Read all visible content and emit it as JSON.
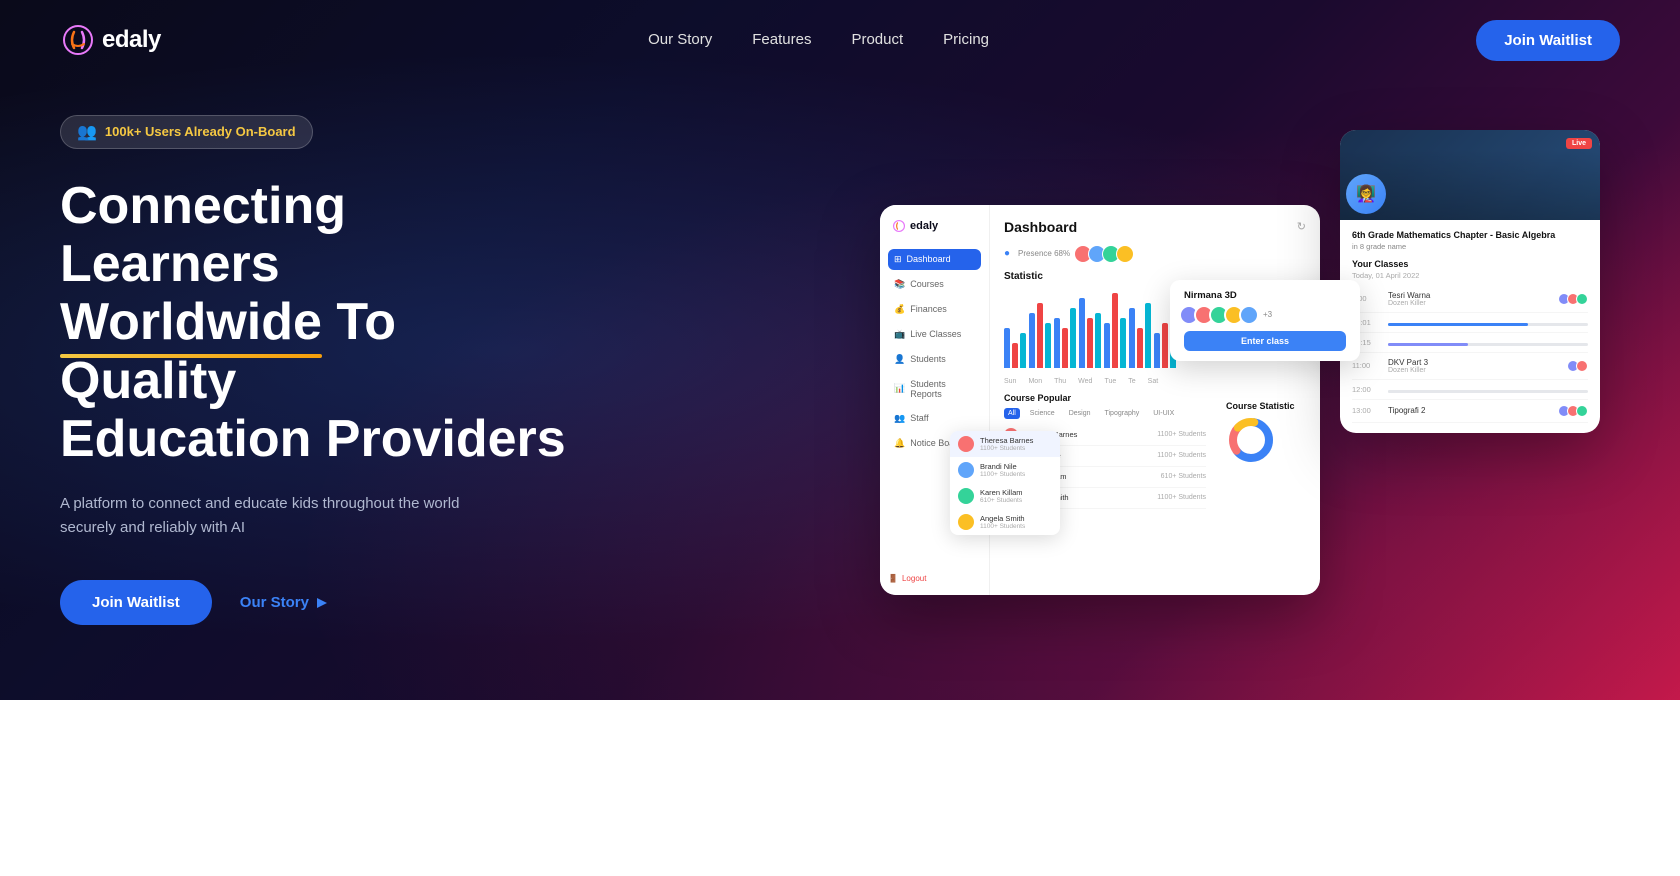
{
  "navbar": {
    "logo_text": "edaly",
    "nav_items": [
      {
        "label": "Our Story",
        "id": "our-story"
      },
      {
        "label": "Features",
        "id": "features"
      },
      {
        "label": "Product",
        "id": "product"
      },
      {
        "label": "Pricing",
        "id": "pricing"
      }
    ],
    "cta_label": "Join Waitlist"
  },
  "hero": {
    "badge_text": "100k+ Users Already On-Board",
    "title_line1": "Connecting Learners",
    "title_line2_start": "",
    "title_underline": "Worldwide",
    "title_line2_end": " To Quality",
    "title_line3": "Education Providers",
    "subtitle": "A platform to connect and educate kids throughout the world securely and reliably with AI",
    "cta_primary": "Join Waitlist",
    "cta_secondary": "Our Story"
  },
  "dashboard": {
    "title": "Dashboard",
    "sidebar_items": [
      {
        "label": "Dashboard",
        "active": true
      },
      {
        "label": "Courses"
      },
      {
        "label": "Finances"
      },
      {
        "label": "Live Classes"
      },
      {
        "label": "Students"
      },
      {
        "label": "Students Reports"
      },
      {
        "label": "Staff"
      },
      {
        "label": "Notice Board"
      }
    ],
    "stat_label": "Statistic",
    "chart_days": [
      "Sun",
      "Mon",
      "Thu",
      "Wed",
      "Tue",
      "Te",
      "Sat"
    ],
    "course_popular": "Course Popular",
    "course_tabs": [
      "All",
      "Science",
      "Design",
      "Tipography",
      "UI-UIX"
    ],
    "course_stat": "Course Statistic",
    "table_rows": [
      {
        "name": "Theresa Barnes",
        "info": "1100+ Students",
        "color": "#f87171"
      },
      {
        "name": "Brandi Nile",
        "info": "1100+ Students",
        "color": "#60a5fa"
      },
      {
        "name": "Karen Killam",
        "info": "610+ Students",
        "color": "#34d399"
      },
      {
        "name": "Angela Smith",
        "info": "1100+ Students",
        "color": "#fbbf24"
      }
    ]
  },
  "side_panel": {
    "class_title": "6th Grade Mathematics Chapter - Basic Algebra",
    "class_sub": "in 8 grade name",
    "section_title": "Your Classes",
    "date": "Today, 01 April 2022",
    "live_badge": "Live",
    "enter_class": "Enter class",
    "popup_class": "Nirmana 3D",
    "class_items": [
      {
        "time": "8:00",
        "name": "Tesri Warna",
        "sub": "Dozen Killer"
      },
      {
        "time": "08:01",
        "name": "",
        "progress": 70
      },
      {
        "time": "08:15",
        "name": "",
        "progress": 40
      },
      {
        "time": "11:00",
        "name": "DKV Part 3",
        "sub": "Dozen Killer"
      },
      {
        "time": "12:00",
        "name": ""
      },
      {
        "time": "13:00",
        "name": "Tipografi 2"
      }
    ]
  }
}
